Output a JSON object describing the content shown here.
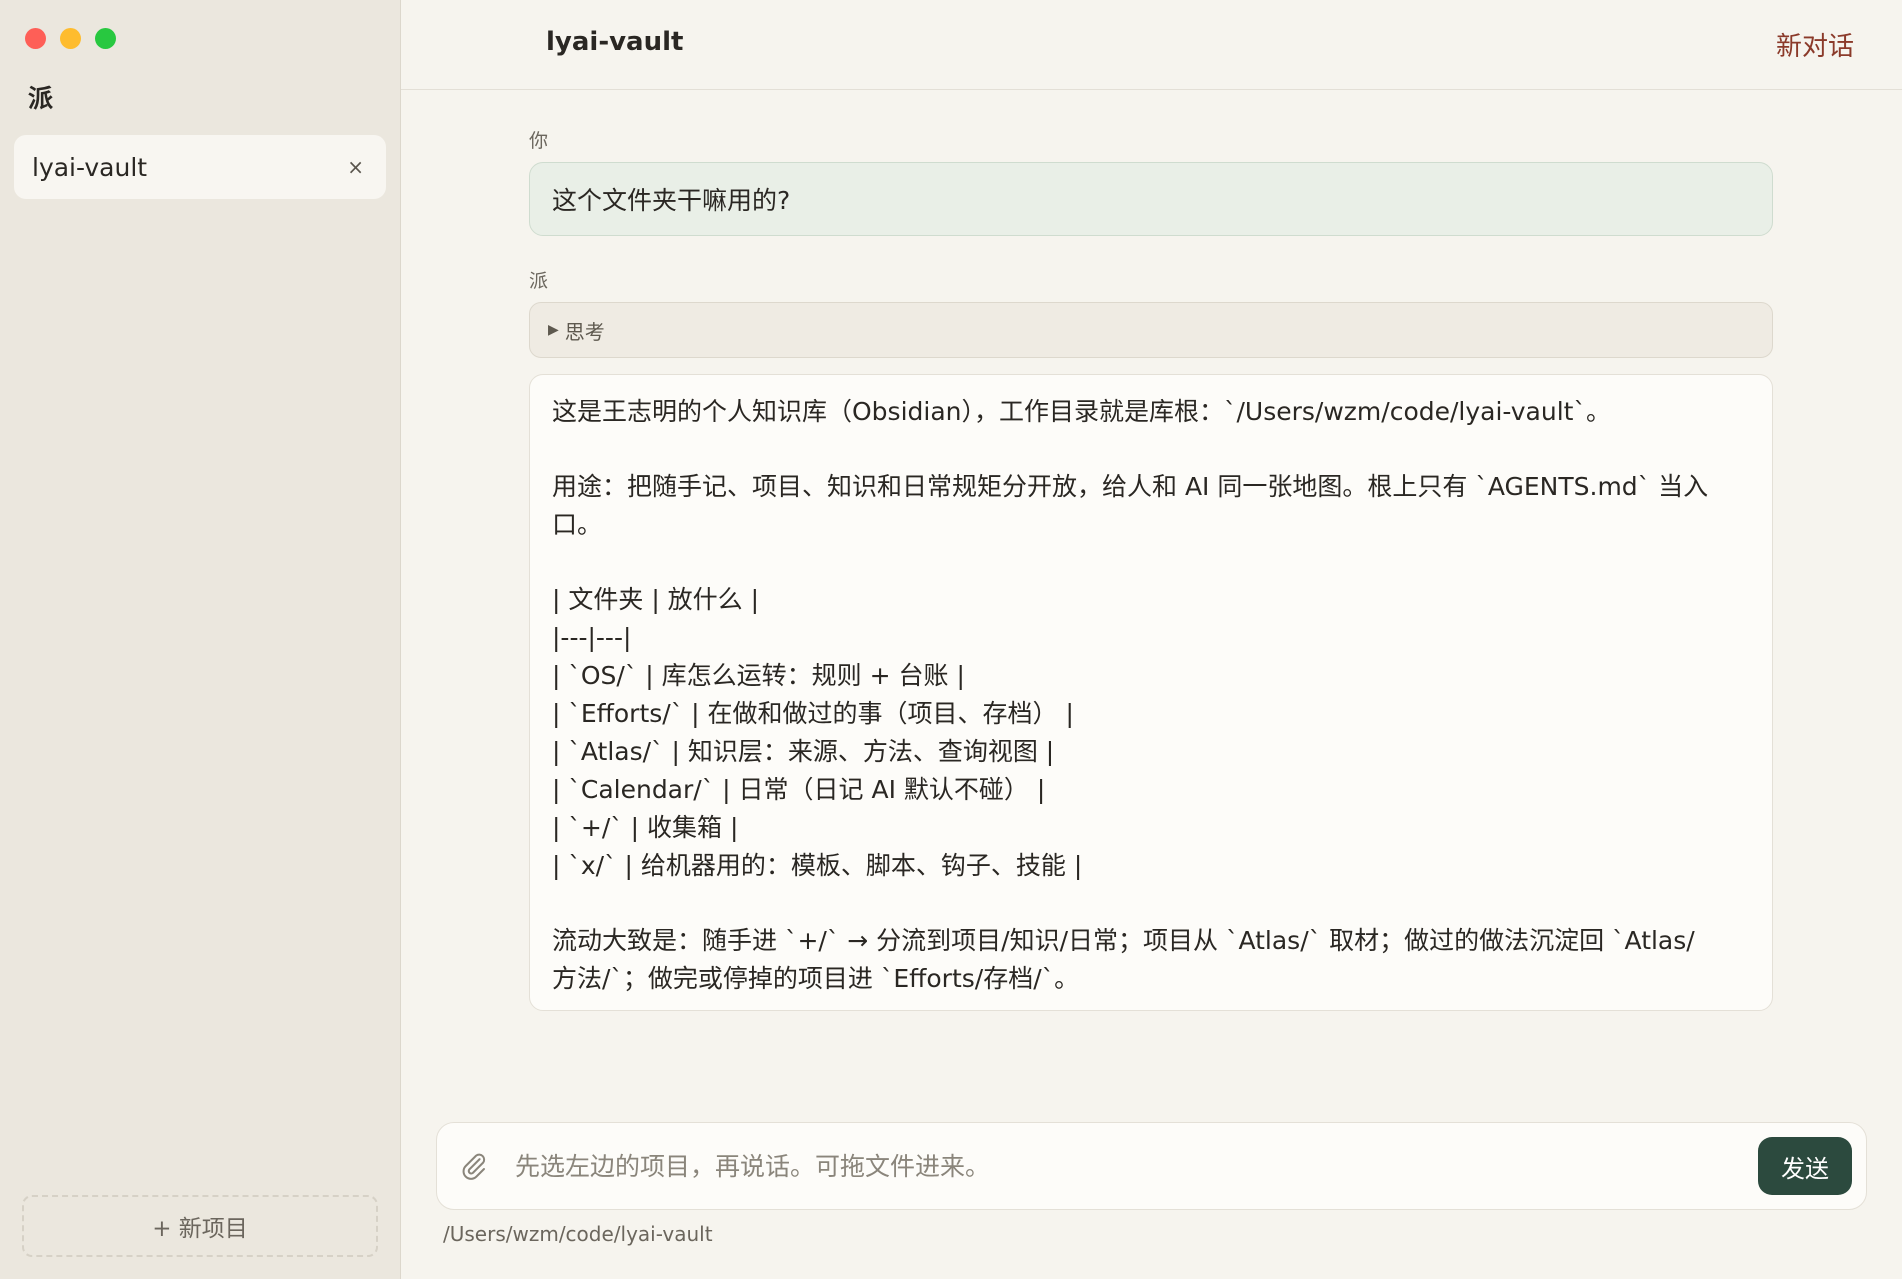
{
  "sidebar": {
    "app_name": "派",
    "projects": [
      {
        "label": "lyai-vault",
        "close": "×"
      }
    ],
    "new_project_label": "+ 新项目"
  },
  "header": {
    "title": "lyai-vault",
    "new_chat_label": "新对话"
  },
  "chat": {
    "user_label": "你",
    "user_message": "这个文件夹干嘛用的?",
    "assistant_label": "派",
    "thinking": {
      "arrow": "▶",
      "label": "思考"
    },
    "assistant_paragraphs": [
      "这是王志明的个人知识库（Obsidian），工作目录就是库根：`/Users/wzm/code/lyai-vault`。",
      "用途：把随手记、项目、知识和日常规矩分开放，给人和 AI 同一张地图。根上只有 `AGENTS.md` 当入\n口。",
      "| 文件夹 | 放什么 |\n|---|---|\n| `OS/` | 库怎么运转：规则 + 台账 |\n| `Efforts/` | 在做和做过的事（项目、存档） |\n| `Atlas/` | 知识层：来源、方法、查询视图 |\n| `Calendar/` | 日常（日记 AI 默认不碰） |\n| `+/` | 收集箱 |\n| `x/` | 给机器用的：模板、脚本、钩子、技能 |",
      "流动大致是：随手进 `+/` → 分流到项目/知识/日常；项目从 `Atlas/` 取材；做过的做法沉淀回 `Atlas/\n方法/`；做完或停掉的项目进 `Efforts/存档/`。"
    ]
  },
  "composer": {
    "placeholder": "先选左边的项目，再说话。可拖文件进来。",
    "send_label": "发送",
    "attach_icon": "paperclip-icon"
  },
  "footer": {
    "cwd_path": "/Users/wzm/code/lyai-vault"
  }
}
